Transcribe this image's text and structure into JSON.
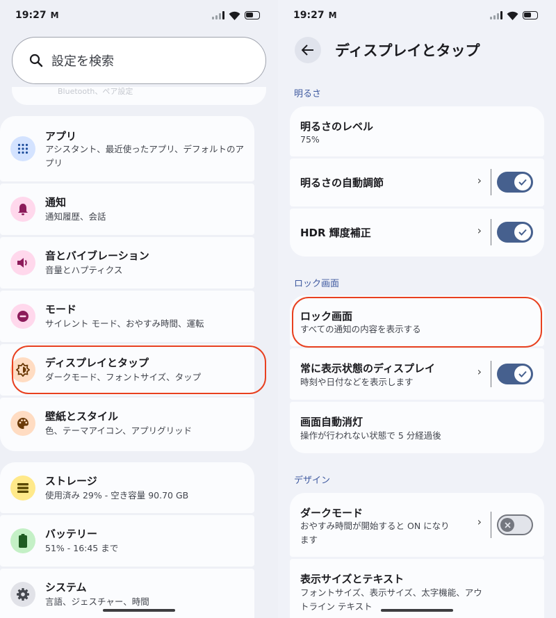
{
  "status_bar": {
    "time": "19:27",
    "notification_glyph": "M"
  },
  "left": {
    "search": {
      "placeholder": "設定を検索"
    },
    "top_peek_text": "Bluetooth、ペア設定",
    "items": [
      {
        "title": "アプリ",
        "subtitle": "アシスタント、最近使ったアプリ、デフォルトのアプリ",
        "icon": "apps-grid-icon",
        "icon_bg": "#d4e3ff",
        "icon_color": "#1f4e9c"
      },
      {
        "title": "通知",
        "subtitle": "通知履歴、会話",
        "icon": "bell-icon",
        "icon_bg": "#ffd8ec",
        "icon_color": "#8c1b5a"
      },
      {
        "title": "音とバイブレーション",
        "subtitle": "音量とハプティクス",
        "icon": "volume-icon",
        "icon_bg": "#ffd8ec",
        "icon_color": "#8c1b5a"
      },
      {
        "title": "モード",
        "subtitle": "サイレント モード、おやすみ時間、運転",
        "icon": "do-not-disturb-icon",
        "icon_bg": "#ffd8ec",
        "icon_color": "#8c1b5a"
      },
      {
        "title": "ディスプレイとタップ",
        "subtitle": "ダークモード、フォントサイズ、タップ",
        "icon": "brightness-icon",
        "icon_bg": "#ffdcc2",
        "icon_color": "#6b3a08"
      },
      {
        "title": "壁紙とスタイル",
        "subtitle": "色、テーマアイコン、アプリグリッド",
        "icon": "palette-icon",
        "icon_bg": "#ffdcc2",
        "icon_color": "#6b3a08"
      },
      {
        "title": "ストレージ",
        "subtitle": "使用済み 29% - 空き容量 90.70 GB",
        "icon": "storage-icon",
        "icon_bg": "#ffe98a",
        "icon_color": "#5a4800"
      },
      {
        "title": "バッテリー",
        "subtitle": "51% - 16:45 まで",
        "icon": "battery-icon",
        "icon_bg": "#c4f0c6",
        "icon_color": "#1e5b22"
      },
      {
        "title": "システム",
        "subtitle": "言語、ジェスチャー、時間",
        "icon": "gear-icon",
        "icon_bg": "#e1e2e8",
        "icon_color": "#44474e"
      }
    ]
  },
  "right": {
    "page_title": "ディスプレイとタップ",
    "sections": {
      "brightness": "明るさ",
      "lock_screen": "ロック画面",
      "design": "デザイン"
    },
    "items": {
      "brightness_level": {
        "title": "明るさのレベル",
        "value": "75%"
      },
      "adaptive_brightness": {
        "title": "明るさの自動調節",
        "toggle": true
      },
      "hdr": {
        "title": "HDR 輝度補正",
        "toggle": true
      },
      "lock_screen": {
        "title": "ロック画面",
        "subtitle": "すべての通知の内容を表示する"
      },
      "always_on": {
        "title": "常に表示状態のディスプレイ",
        "subtitle": "時刻や日付などを表示します",
        "toggle": true
      },
      "screen_timeout": {
        "title": "画面自動消灯",
        "subtitle": "操作が行われない状態で 5 分経過後"
      },
      "dark_mode": {
        "title": "ダークモード",
        "subtitle": "おやすみ時間が開始すると ON になります",
        "toggle": false
      },
      "display_size": {
        "title": "表示サイズとテキスト",
        "subtitle": "フォントサイズ、表示サイズ、太字機能、アウトライン テキスト"
      }
    }
  },
  "colors": {
    "accent": "#46608e",
    "highlight": "#e8401f",
    "section_label": "#3f5aa0"
  }
}
